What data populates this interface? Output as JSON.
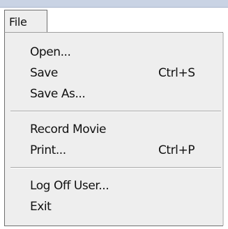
{
  "menubar": {
    "file_label": "File"
  },
  "menu": {
    "items": [
      {
        "label": "Open...",
        "shortcut": ""
      },
      {
        "label": "Save",
        "shortcut": "Ctrl+S"
      },
      {
        "label": "Save As...",
        "shortcut": ""
      },
      {
        "label": "Record Movie",
        "shortcut": ""
      },
      {
        "label": "Print...",
        "shortcut": "Ctrl+P"
      },
      {
        "label": "Log Off User...",
        "shortcut": ""
      },
      {
        "label": "Exit",
        "shortcut": ""
      }
    ]
  }
}
